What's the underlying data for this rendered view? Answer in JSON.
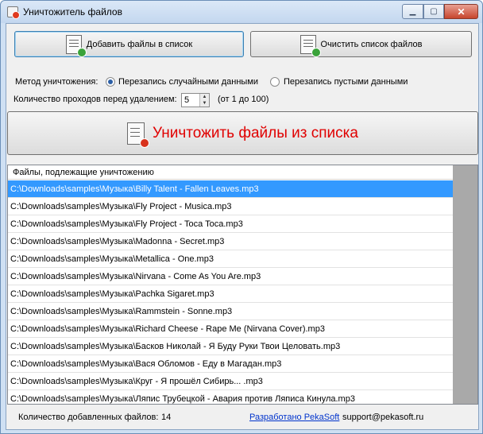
{
  "window": {
    "title": "Уничтожитель файлов"
  },
  "toolbar": {
    "add_label": "Добавить файлы в список",
    "clear_label": "Очистить список файлов"
  },
  "method": {
    "label": "Метод уничтожения:",
    "options": [
      "Перезапись случайными данными",
      "Перезапись пустыми данными"
    ],
    "selected_index": 0
  },
  "passes": {
    "label": "Количество проходов перед удалением:",
    "value": "5",
    "range_hint": "(от 1 до 100)"
  },
  "destroy": {
    "label": "Уничтожить файлы из списка"
  },
  "file_list": {
    "header": "Файлы, подлежащие уничтожению",
    "selected_index": 0,
    "rows": [
      "C:\\Downloads\\samples\\Музыка\\Billy Talent - Fallen Leaves.mp3",
      "C:\\Downloads\\samples\\Музыка\\Fly Project - Musica.mp3",
      "C:\\Downloads\\samples\\Музыка\\Fly Project - Toca Toca.mp3",
      "C:\\Downloads\\samples\\Музыка\\Madonna - Secret.mp3",
      "C:\\Downloads\\samples\\Музыка\\Metallica - One.mp3",
      "C:\\Downloads\\samples\\Музыка\\Nirvana - Come As You Are.mp3",
      "C:\\Downloads\\samples\\Музыка\\Pachka Sigaret.mp3",
      "C:\\Downloads\\samples\\Музыка\\Rammstein - Sonne.mp3",
      "C:\\Downloads\\samples\\Музыка\\Richard Cheese - Rape Me (Nirvana Cover).mp3",
      "C:\\Downloads\\samples\\Музыка\\Басков Николай - Я Буду Руки Твои Целовать.mp3",
      "C:\\Downloads\\samples\\Музыка\\Вася Обломов - Еду в Магадан.mp3",
      "C:\\Downloads\\samples\\Музыка\\Круг - Я прошёл Сибирь... .mp3",
      "C:\\Downloads\\samples\\Музыка\\Ляпис Трубецкой - Авария против Ляписа Кинула.mp3"
    ]
  },
  "status": {
    "count_label": "Количество добавленных файлов:",
    "count_value": "14",
    "developer_link": "Разработано PekaSoft",
    "email": "support@pekasoft.ru"
  },
  "colors": {
    "selection": "#3399ff",
    "destroy_text": "#e00000",
    "link": "#0033cc"
  }
}
